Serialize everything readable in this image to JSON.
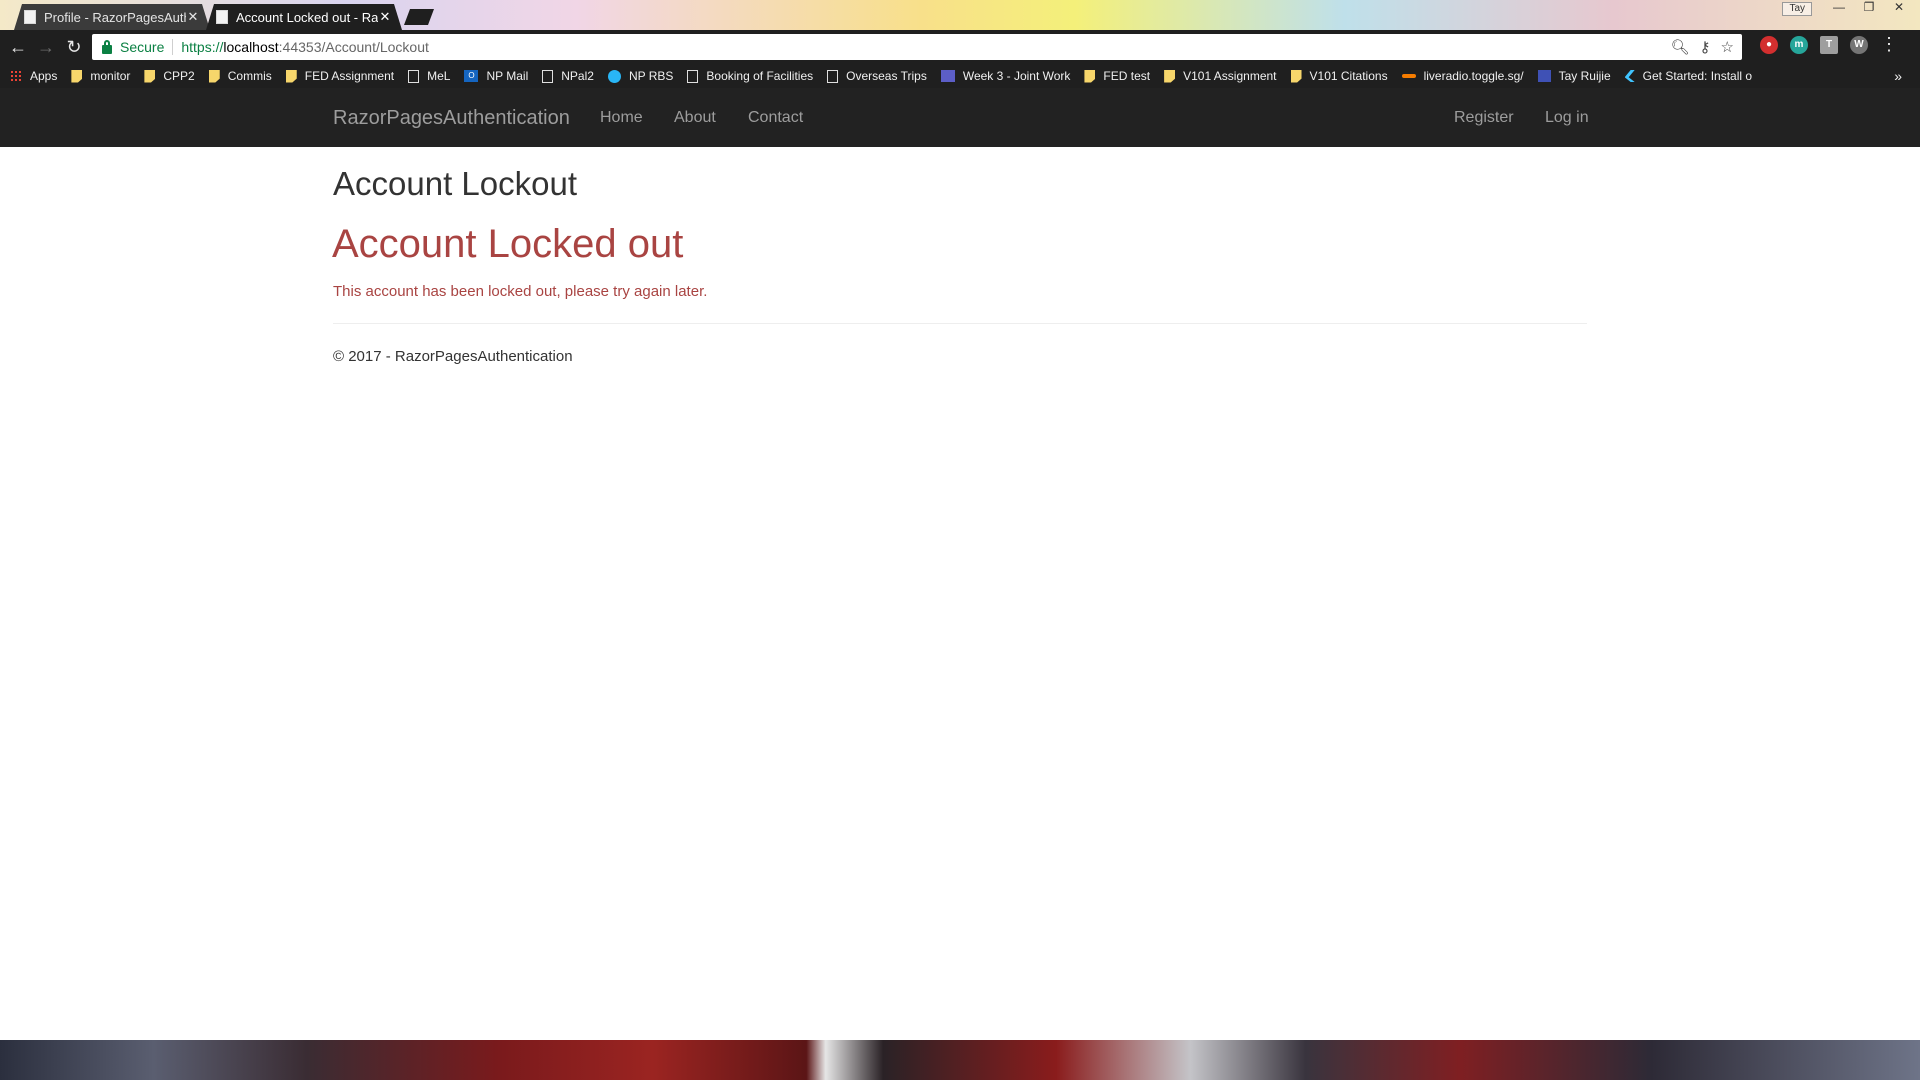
{
  "browser": {
    "tabs": [
      {
        "title": "Profile - RazorPagesAuth",
        "active": false
      },
      {
        "title": "Account Locked out - Ra",
        "active": true
      }
    ],
    "user_chip": "Tay",
    "address": {
      "security_label": "Secure",
      "url_scheme": "https://",
      "url_host": "localhost",
      "url_path": ":44353/Account/Lockout"
    },
    "bookmarks": [
      {
        "label": "Apps",
        "icon": "apps-grid-icon"
      },
      {
        "label": "monitor",
        "icon": "folder-icon"
      },
      {
        "label": "CPP2",
        "icon": "folder-icon"
      },
      {
        "label": "Commis",
        "icon": "folder-icon"
      },
      {
        "label": "FED Assignment",
        "icon": "folder-icon"
      },
      {
        "label": "MeL",
        "icon": "page-icon"
      },
      {
        "label": "NP Mail",
        "icon": "outlook-icon"
      },
      {
        "label": "NPal2",
        "icon": "page-icon"
      },
      {
        "label": "NP RBS",
        "icon": "circle-icon"
      },
      {
        "label": "Booking of Facilities",
        "icon": "page-icon"
      },
      {
        "label": "Overseas Trips",
        "icon": "page-icon"
      },
      {
        "label": "Week 3 - Joint Work",
        "icon": "teams-icon"
      },
      {
        "label": "FED test",
        "icon": "folder-icon"
      },
      {
        "label": "V101 Assignment",
        "icon": "folder-icon"
      },
      {
        "label": "V101 Citations",
        "icon": "folder-icon"
      },
      {
        "label": "liveradio.toggle.sg/",
        "icon": "radio-icon"
      },
      {
        "label": "Tay Ruijie",
        "icon": "calendar-icon"
      },
      {
        "label": "Get Started: Install o",
        "icon": "flutter-icon"
      }
    ],
    "bookmarks_more": "»"
  },
  "navbar": {
    "brand": "RazorPagesAuthentication",
    "links": [
      "Home",
      "About",
      "Contact"
    ],
    "right_links": [
      "Register",
      "Log in"
    ]
  },
  "content": {
    "page_title": "Account Lockout",
    "error_heading": "Account Locked out",
    "error_text": "This account has been locked out, please try again later."
  },
  "footer": {
    "text": "© 2017 - RazorPagesAuthentication"
  },
  "colors": {
    "navbar_bg": "#222222",
    "navbar_text": "#9d9d9d",
    "danger_text": "#a94442",
    "body_text": "#333333"
  }
}
